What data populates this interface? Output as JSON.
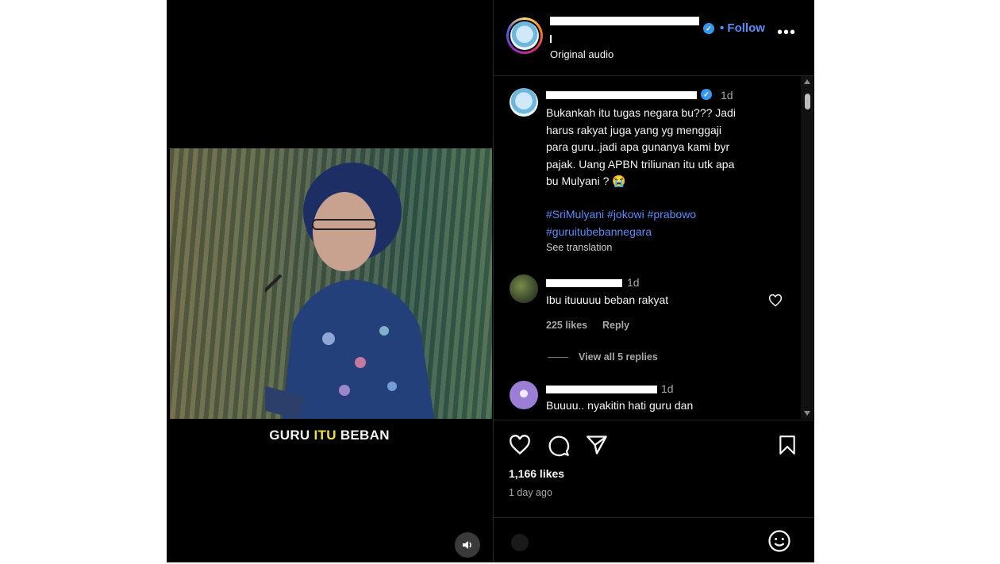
{
  "video": {
    "caption_part1": "GURU ",
    "caption_highlight": "ITU",
    "caption_part2": " BEBAN",
    "caption_highlight_color": "#f0e23b"
  },
  "header": {
    "follow_label": "Follow",
    "audio_label": "Original audio",
    "more_label": "•••"
  },
  "comments": [
    {
      "time": "1d",
      "text_lines": [
        "Bukankah itu tugas negara bu??? Jadi",
        "harus rakyat juga yang yg menggaji",
        "para guru..jadi apa gunanya kami byr",
        "pajak. Uang APBN triliunan itu utk apa",
        "bu Mulyani ? 😭"
      ],
      "hashtags_line1": "#SriMulyani #jokowi #prabowo",
      "hashtags_line2": "#guruitubebannegara",
      "see_translation": "See translation"
    },
    {
      "time": "1d",
      "text": "Ibu ituuuuu beban rakyat",
      "likes": "225 likes",
      "reply": "Reply",
      "view_replies": "View all 5 replies"
    },
    {
      "time": "1d",
      "text": "Buuuu.. nyakitin hati guru dan"
    }
  ],
  "post": {
    "likes": "1,166 likes",
    "ago": "1 day ago"
  },
  "colors": {
    "link_blue": "#5b8cf7",
    "verified_blue": "#3897f0",
    "background": "#000000"
  }
}
